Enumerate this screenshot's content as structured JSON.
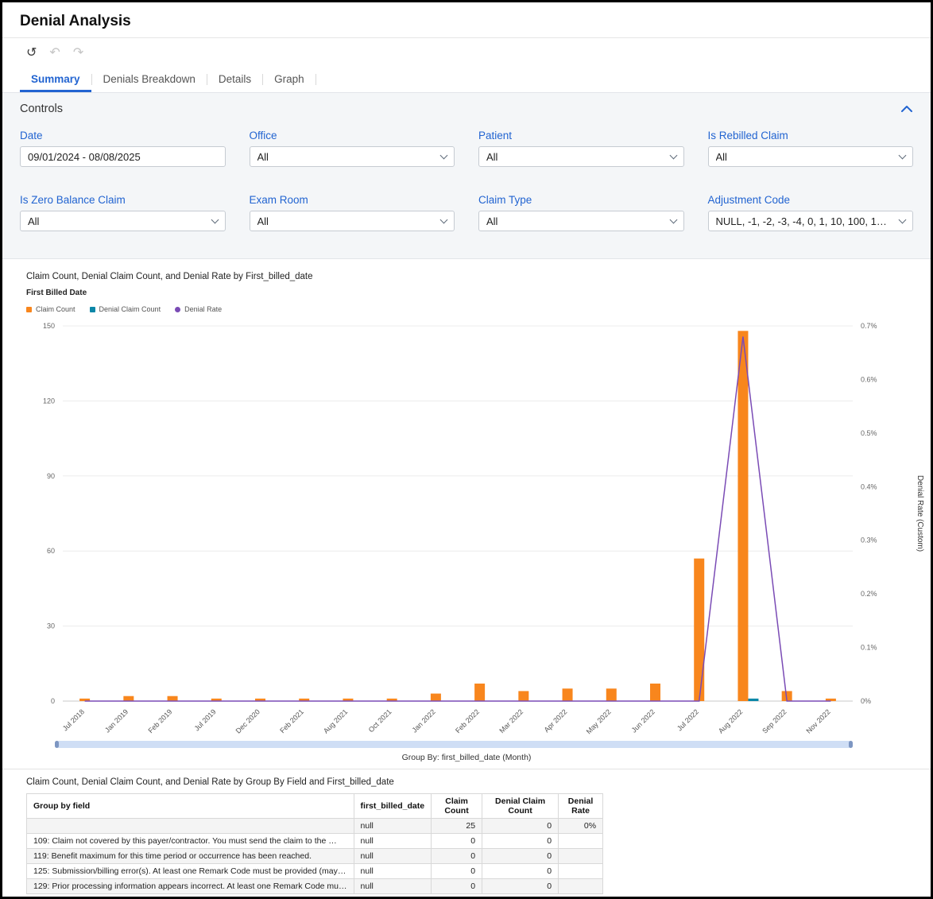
{
  "page": {
    "title": "Denial Analysis"
  },
  "toolbar": {
    "refresh": "↺",
    "undo": "↶",
    "redo": "↷"
  },
  "tabs": {
    "items": [
      {
        "label": "Summary",
        "active": true
      },
      {
        "label": "Denials Breakdown",
        "active": false
      },
      {
        "label": "Details",
        "active": false
      },
      {
        "label": "Graph",
        "active": false
      }
    ]
  },
  "controls": {
    "title": "Controls",
    "fields": [
      {
        "label": "Date",
        "value": "09/01/2024 - 08/08/2025",
        "type": "text"
      },
      {
        "label": "Office",
        "value": "All",
        "type": "select"
      },
      {
        "label": "Patient",
        "value": "All",
        "type": "select"
      },
      {
        "label": "Is Rebilled Claim",
        "value": "All",
        "type": "select"
      },
      {
        "label": "Is Zero Balance Claim",
        "value": "All",
        "type": "select"
      },
      {
        "label": "Exam Room",
        "value": "All",
        "type": "select"
      },
      {
        "label": "Claim Type",
        "value": "All",
        "type": "select"
      },
      {
        "label": "Adjustment Code",
        "value": "NULL, -1, -2, -3, -4, 0, 1, 10, 100, 1…",
        "type": "select"
      }
    ]
  },
  "chart_data": {
    "type": "bar",
    "title": "Claim Count, Denial Claim Count, and Denial Rate by First_billed_date",
    "subtitle": "First Billed Date",
    "categories": [
      "Jul 2018",
      "Jan 2019",
      "Feb 2019",
      "Jul 2019",
      "Dec 2020",
      "Feb 2021",
      "Aug 2021",
      "Oct 2021",
      "Jan 2022",
      "Feb 2022",
      "Mar 2022",
      "Apr 2022",
      "May 2022",
      "Jun 2022",
      "Jul 2022",
      "Aug 2022",
      "Sep 2022",
      "Nov 2022"
    ],
    "series": [
      {
        "name": "Claim Count",
        "type": "bar",
        "color": "#f8861d",
        "values": [
          1,
          2,
          2,
          1,
          1,
          1,
          1,
          1,
          3,
          7,
          4,
          5,
          5,
          7,
          57,
          148,
          4,
          1
        ]
      },
      {
        "name": "Denial Claim Count",
        "type": "bar",
        "color": "#0c87a8",
        "values": [
          0,
          0,
          0,
          0,
          0,
          0,
          0,
          0,
          0,
          0,
          0,
          0,
          0,
          0,
          0,
          1,
          0,
          0
        ]
      },
      {
        "name": "Denial Rate",
        "type": "line",
        "axis": "right",
        "color": "#7a4bb5",
        "values": [
          0,
          0,
          0,
          0,
          0,
          0,
          0,
          0,
          0,
          0,
          0,
          0,
          0,
          0,
          0,
          0.68,
          0,
          0
        ]
      }
    ],
    "left_axis": {
      "ticks": [
        0,
        30,
        60,
        90,
        120,
        150
      ],
      "max": 150
    },
    "right_axis": {
      "ticks": [
        "0%",
        "0.1%",
        "0.2%",
        "0.3%",
        "0.4%",
        "0.5%",
        "0.6%",
        "0.7%"
      ],
      "max": 0.7,
      "label": "Denial Rate (Custom)"
    },
    "grid": true,
    "legend_position": "top-left",
    "footer": "Group By: first_billed_date (Month)"
  },
  "table": {
    "title": "Claim Count, Denial Claim Count, and Denial Rate by Group By Field and First_billed_date",
    "columns": [
      "Group by field",
      "first_billed_date",
      "Claim Count",
      "Denial Claim Count",
      "Denial Rate"
    ],
    "rows": [
      [
        "",
        "null",
        "25",
        "0",
        "0%"
      ],
      [
        "109: Claim not covered by this payer/contractor. You must send the claim to the …",
        "null",
        "0",
        "0",
        ""
      ],
      [
        "119: Benefit maximum for this time period or occurrence has been reached.",
        "null",
        "0",
        "0",
        ""
      ],
      [
        "125: Submission/billing error(s). At least one Remark Code must be provided (may…",
        "null",
        "0",
        "0",
        ""
      ],
      [
        "129: Prior processing information appears incorrect. At least one Remark Code mu…",
        "null",
        "0",
        "0",
        ""
      ]
    ]
  }
}
